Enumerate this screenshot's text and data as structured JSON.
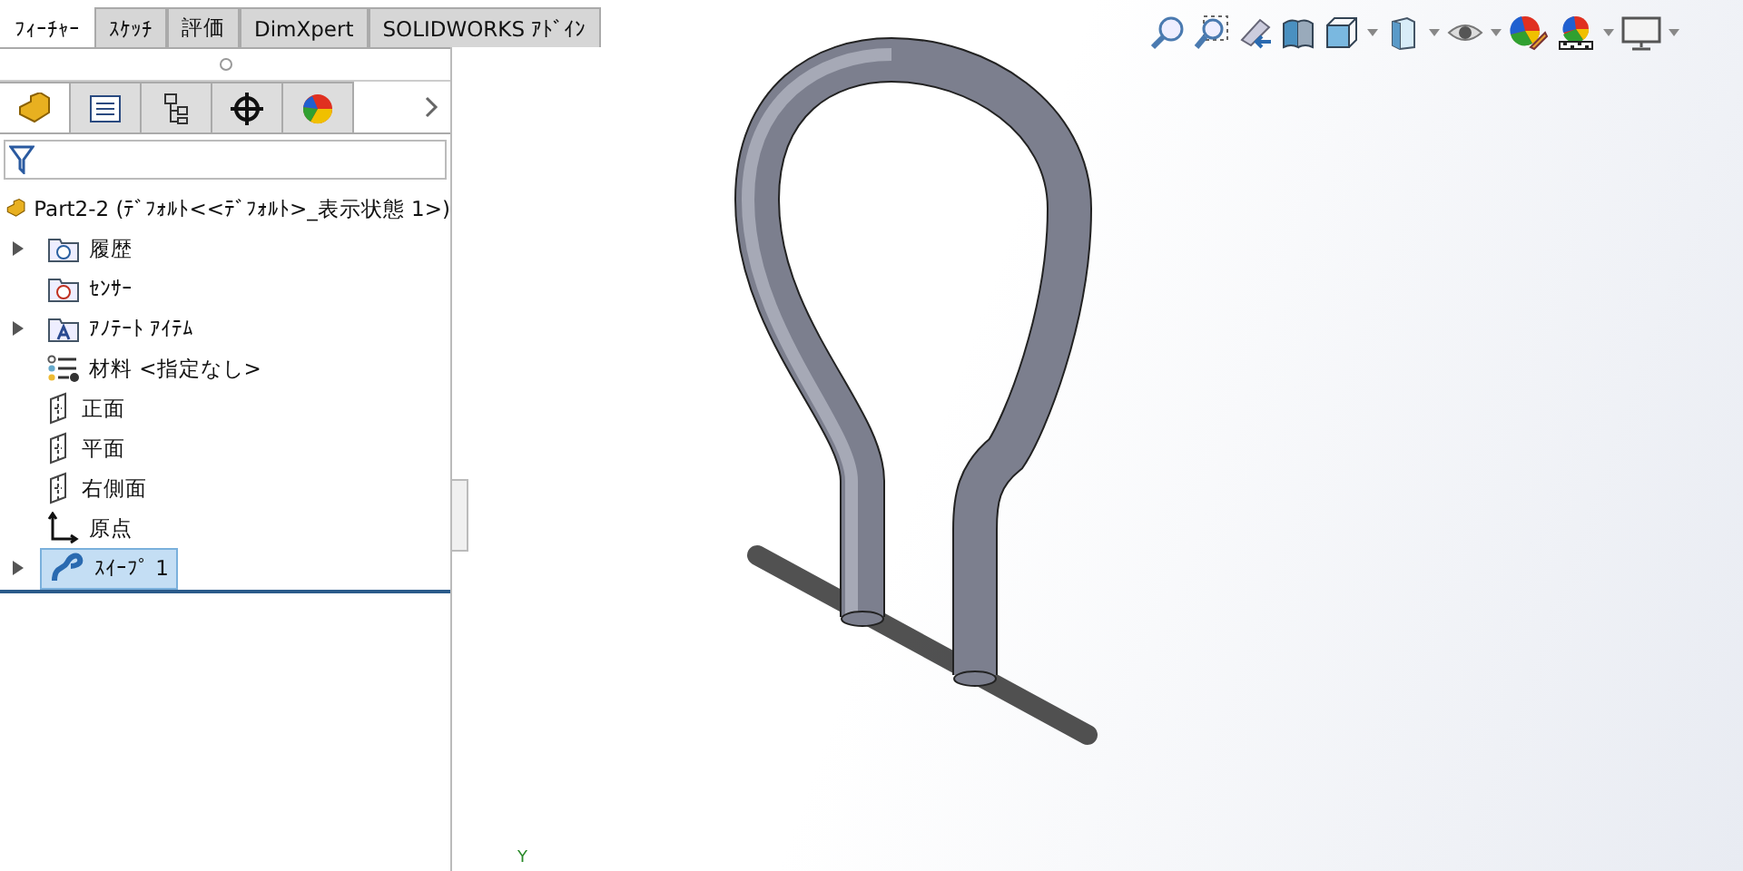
{
  "tabs": [
    {
      "label": "ﾌｨｰﾁｬｰ",
      "selected": true
    },
    {
      "label": "ｽｹｯﾁ",
      "selected": false
    },
    {
      "label": "評価",
      "selected": false
    },
    {
      "label": "DimXpert",
      "selected": false
    },
    {
      "label": "SOLIDWORKS ｱﾄﾞｲﾝ",
      "selected": false
    }
  ],
  "panel_tabs": [
    {
      "kind": "feature",
      "selected": true
    },
    {
      "kind": "property",
      "selected": false
    },
    {
      "kind": "config",
      "selected": false
    },
    {
      "kind": "dimxpert",
      "selected": false
    },
    {
      "kind": "display",
      "selected": false
    }
  ],
  "tree": {
    "label": "Part2-2 (ﾃﾞﾌｫﾙﾄ<<ﾃﾞﾌｫﾙﾄ>_表示状態 1>)",
    "children": [
      {
        "label": "履歴",
        "kind": "history",
        "expandable": true,
        "selected": false
      },
      {
        "label": "ｾﾝｻｰ",
        "kind": "sensor",
        "expandable": false,
        "selected": false
      },
      {
        "label": "ｱﾉﾃｰﾄ ｱｲﾃﾑ",
        "kind": "annotation",
        "expandable": true,
        "selected": false
      },
      {
        "label": "材料 <指定なし>",
        "kind": "material",
        "expandable": false,
        "selected": false
      },
      {
        "label": "正面",
        "kind": "plane",
        "expandable": false,
        "selected": false
      },
      {
        "label": "平面",
        "kind": "plane",
        "expandable": false,
        "selected": false
      },
      {
        "label": "右側面",
        "kind": "plane",
        "expandable": false,
        "selected": false
      },
      {
        "label": "原点",
        "kind": "origin",
        "expandable": false,
        "selected": false
      },
      {
        "label": "ｽｲｰﾌﾟ 1",
        "kind": "sweep",
        "expandable": true,
        "selected": true
      }
    ]
  },
  "viewport": {
    "axis_label": "Y"
  }
}
